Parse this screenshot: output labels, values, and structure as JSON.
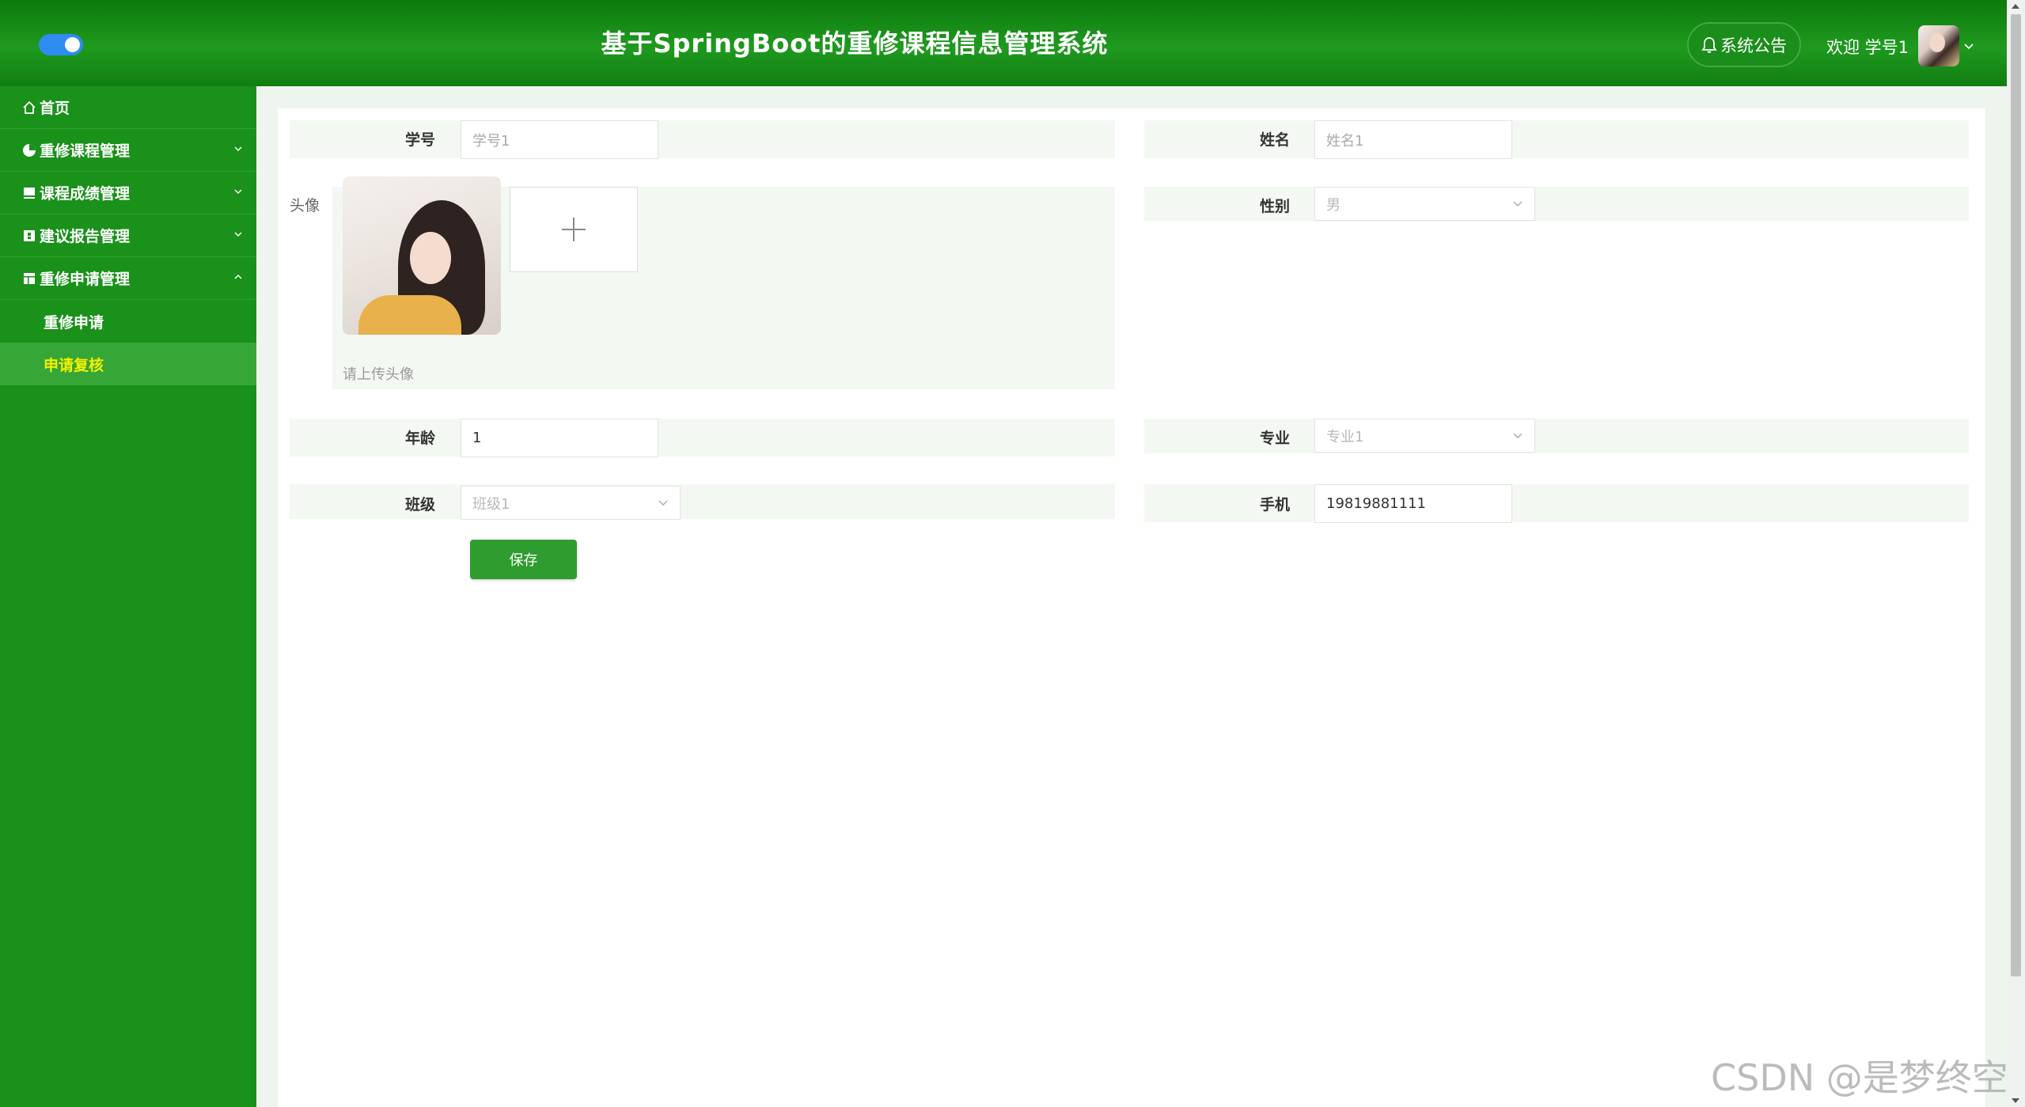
{
  "header": {
    "title": "基于SpringBoot的重修课程信息管理系统",
    "notice_label": "系统公告",
    "welcome": "欢迎 学号1"
  },
  "sidebar": {
    "items": [
      {
        "label": "首页",
        "icon": "home-icon"
      },
      {
        "label": "重修课程管理",
        "icon": "pie-chart-icon"
      },
      {
        "label": "课程成绩管理",
        "icon": "document-icon"
      },
      {
        "label": "建议报告管理",
        "icon": "report-icon"
      },
      {
        "label": "重修申请管理",
        "icon": "table-icon"
      }
    ],
    "sub_items": [
      {
        "label": "重修申请"
      },
      {
        "label": "申请复核"
      }
    ]
  },
  "form": {
    "student_id": {
      "label": "学号",
      "value": "学号1"
    },
    "name": {
      "label": "姓名",
      "value": "姓名1"
    },
    "avatar": {
      "label": "头像",
      "hint": "请上传头像"
    },
    "gender": {
      "label": "性别",
      "value": "男"
    },
    "age": {
      "label": "年龄",
      "value": "1"
    },
    "major": {
      "label": "专业",
      "value": "专业1"
    },
    "class": {
      "label": "班级",
      "value": "班级1"
    },
    "phone": {
      "label": "手机",
      "value": "19819881111"
    },
    "save_label": "保存"
  },
  "watermark": "CSDN @是梦终空",
  "colors": {
    "header_green": "#1a911a",
    "active_text": "#f4f000",
    "toggle_blue": "#2f8cf0",
    "save_button": "#2e9c2e"
  }
}
